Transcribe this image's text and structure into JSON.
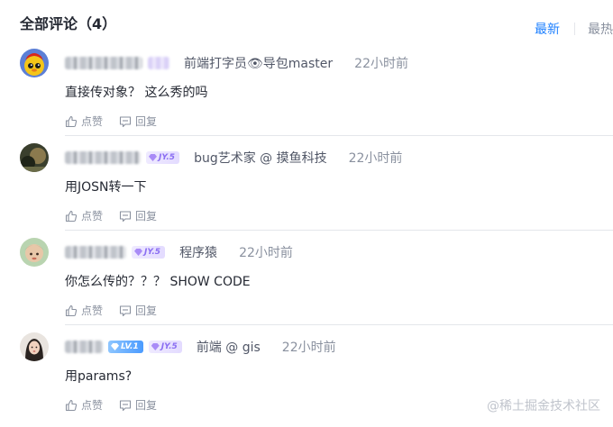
{
  "header": {
    "title": "全部评论（4）",
    "sort_tabs": [
      {
        "label": "最新",
        "active": true
      },
      {
        "label": "最热",
        "active": false
      }
    ]
  },
  "comments": [
    {
      "role": "前端打字员👁导包master",
      "time": "22小时前",
      "content": "直接传对象？ 这么秀的吗",
      "like_label": "点赞",
      "reply_label": "回复",
      "badges": []
    },
    {
      "role": "bug艺术家 @ 摸鱼科技",
      "time": "22小时前",
      "content": "用JOSN转一下",
      "like_label": "点赞",
      "reply_label": "回复",
      "badges": [
        "JY.5"
      ]
    },
    {
      "role": "程序猿",
      "time": "22小时前",
      "content": "你怎么传的？？？  SHOW CODE",
      "like_label": "点赞",
      "reply_label": "回复",
      "badges": [
        "JY.5"
      ]
    },
    {
      "role": "前端 @ gis",
      "time": "22小时前",
      "content": "用params?",
      "like_label": "点赞",
      "reply_label": "回复",
      "badges": [
        "LV.1",
        "JY.5"
      ]
    }
  ],
  "watermark": "@稀土掘金技术社区",
  "colors": {
    "accent": "#1e80ff",
    "muted": "#8a919f",
    "text": "#252933",
    "divider": "#e4e6eb"
  },
  "icons": {
    "like": "thumbs-up-icon",
    "reply": "comment-icon"
  }
}
